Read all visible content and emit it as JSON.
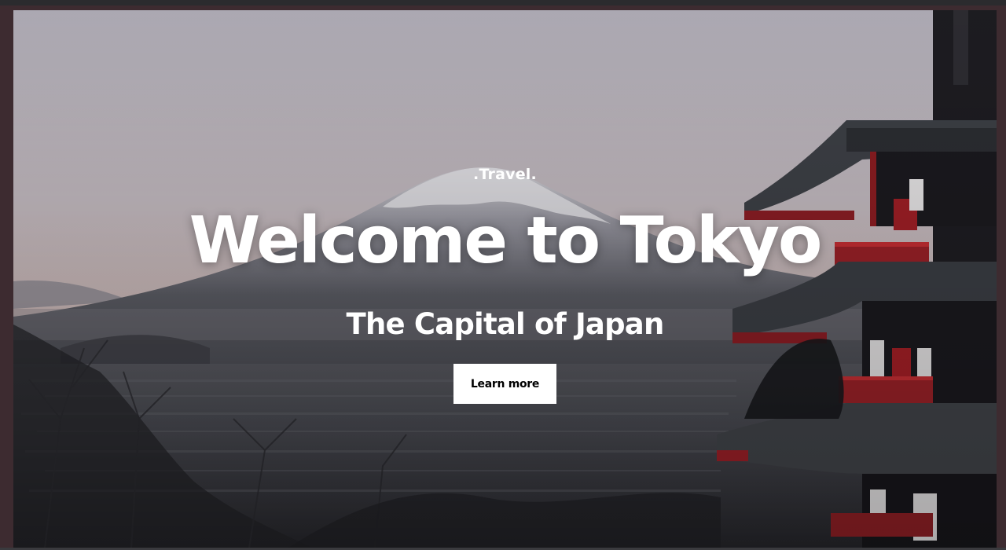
{
  "hero": {
    "brand": ".Travel.",
    "headline": "Welcome to Tokyo",
    "subheadline": "The Capital of Japan",
    "cta_label": "Learn more"
  },
  "colors": {
    "text": "#ffffff",
    "button_bg": "#ffffff",
    "button_text": "#000000",
    "frame": "#3d2b30"
  }
}
